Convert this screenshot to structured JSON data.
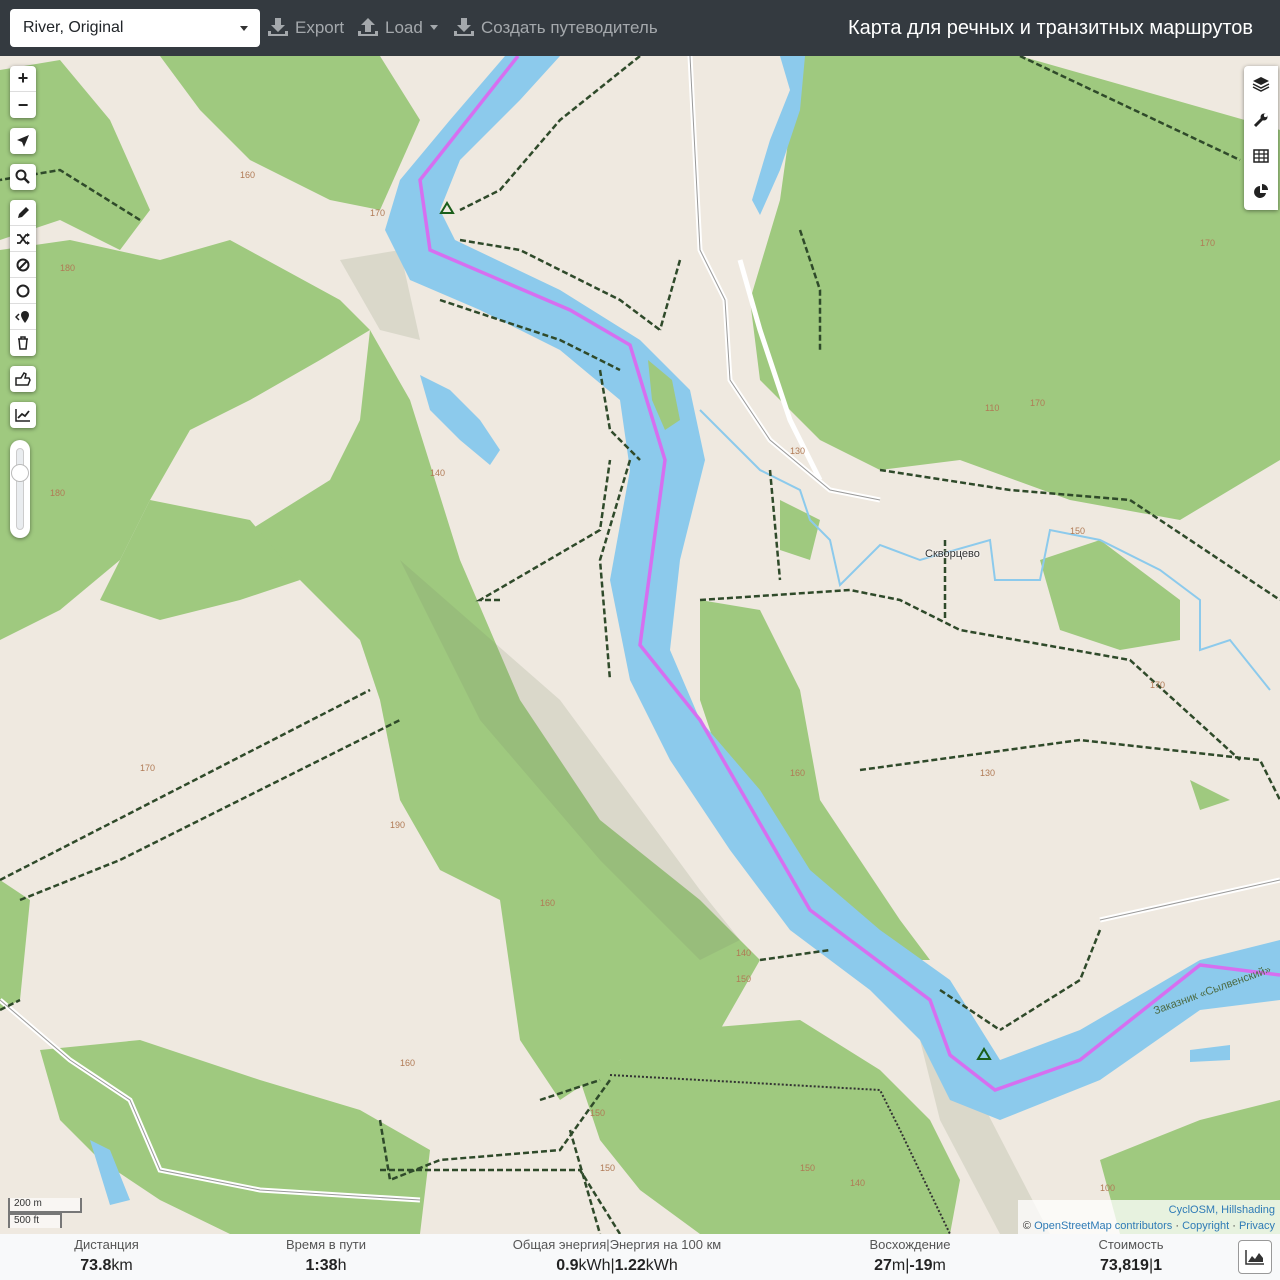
{
  "topbar": {
    "profile": "River, Original",
    "export_label": "Export",
    "load_label": "Load",
    "guide_label": "Создать путеводитель",
    "title": "Карта для речных и транзитных маршрутов"
  },
  "map": {
    "place_label": "Скворцево",
    "reserve_label": "Заказник «Сылвенский»",
    "contour_labels": [
      "180",
      "180",
      "170",
      "160",
      "190",
      "140",
      "160",
      "150",
      "140",
      "150",
      "160",
      "130",
      "110",
      "170",
      "170",
      "150",
      "170",
      "130",
      "100",
      "150",
      "170",
      "160",
      "150",
      "140",
      "150"
    ],
    "scale": {
      "metric": "200 m",
      "imperial": "500 ft"
    },
    "attribution": {
      "tiles": "CyclOSM, Hillshading",
      "prefix": "©",
      "osm": "OpenStreetMap contributors",
      "copyright": "Copyright",
      "privacy": "Privacy",
      "separator": "·"
    }
  },
  "controls": {
    "zoom_in": "+",
    "zoom_out": "−",
    "left_icons": [
      "locate-icon",
      "search-icon",
      "draw-icon",
      "shuffle-icon",
      "no-entry-icon",
      "circle-icon",
      "marker-icon",
      "trash-icon",
      "thumb-icon",
      "elevation-icon"
    ],
    "right_icons": [
      "layers-icon",
      "wrench-icon",
      "table-icon",
      "pie-chart-icon"
    ],
    "opacity_level": 0.2
  },
  "stats": {
    "distance": {
      "label": "Дистанция",
      "value": "73.8",
      "unit": "km"
    },
    "time": {
      "label": "Время в пути",
      "value": "1:38",
      "unit": "h"
    },
    "energy": {
      "label": "Общая энергия|Энергия на 100 км",
      "value": "0.9",
      "unit": "kWh",
      "value2": "1.22",
      "unit2": "kWh",
      "sep": "|"
    },
    "ascent": {
      "label": "Восхождение",
      "value": "27",
      "unit": "m",
      "value2": "-19",
      "unit2": "m",
      "sep": "|"
    },
    "cost": {
      "label": "Стоимость",
      "value": "73,819",
      "value2": "1",
      "sep": "|"
    }
  },
  "colors": {
    "forest": "#9fc97f",
    "water": "#8ccaec",
    "route": "#d66ff0",
    "land": "#efe9e0",
    "track": "#2f4a2a",
    "topbar": "#343a40"
  }
}
